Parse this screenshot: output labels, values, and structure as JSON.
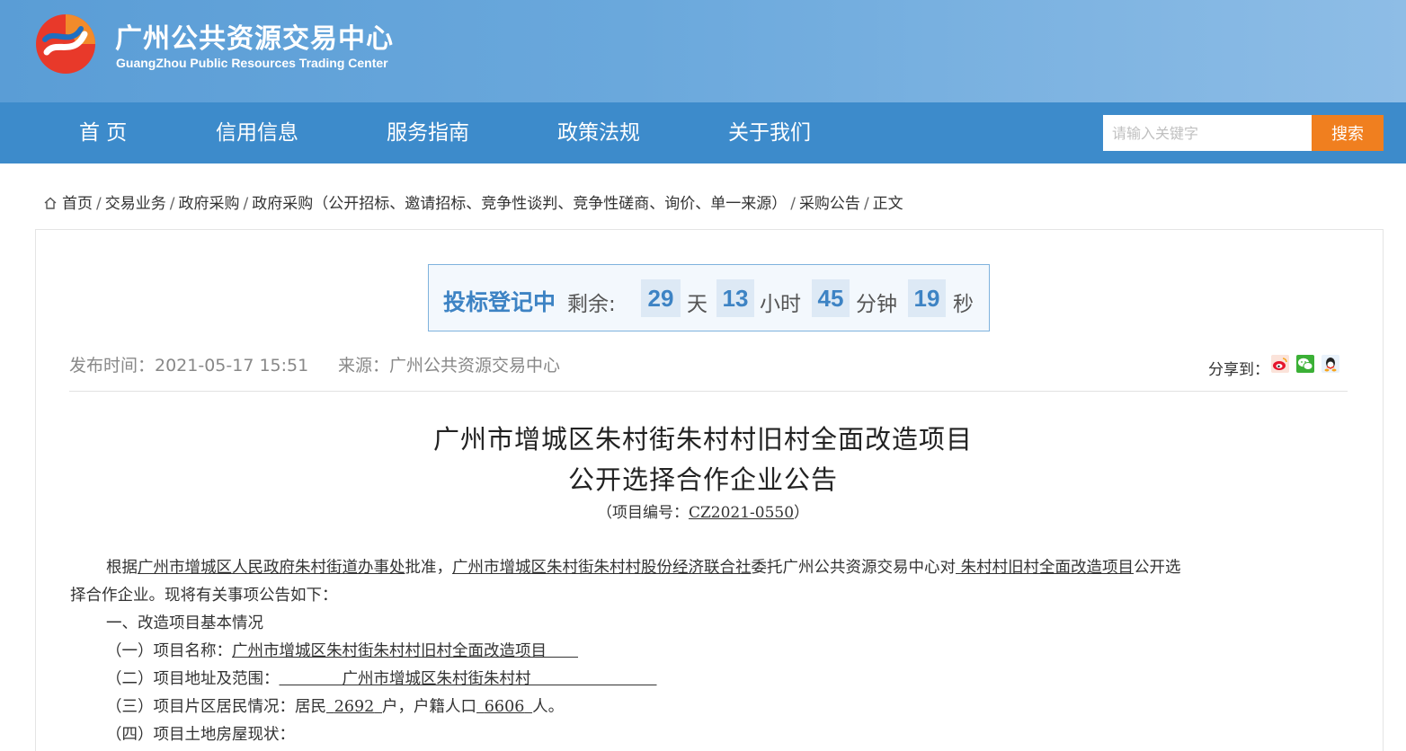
{
  "header": {
    "site_title": "广州公共资源交易中心",
    "site_subtitle": "GuangZhou Public Resources Trading Center",
    "logo_icon": "gzggzy-logo-icon"
  },
  "nav": {
    "items": [
      "首 页",
      "信用信息",
      "服务指南",
      "政策法规",
      "关于我们"
    ],
    "search_placeholder": "请输入关键字",
    "search_button": "搜索"
  },
  "breadcrumb": {
    "items": [
      "首页",
      "交易业务",
      "政府采购",
      "政府采购（公开招标、邀请招标、竞争性谈判、竞争性磋商、询价、单一来源）",
      "采购公告",
      "正文"
    ],
    "separator": "/"
  },
  "countdown": {
    "status": "投标登记中",
    "label": "剩余:",
    "days": "29",
    "days_unit": "天",
    "hours": "13",
    "hours_unit": "小时",
    "minutes": "45",
    "minutes_unit": "分钟",
    "seconds": "19",
    "seconds_unit": "秒"
  },
  "meta": {
    "publish_time": "发布时间：2021-05-17 15:51",
    "source": "来源：广州公共资源交易中心",
    "share_label": "分享到："
  },
  "share_icons": [
    "weibo-icon",
    "wechat-icon",
    "qq-icon"
  ],
  "colors": {
    "accent": "#3d8bcb",
    "search_button": "#f07f1f",
    "countdown": "#3d83c4"
  },
  "document": {
    "title_line1": "广州市增城区朱村街朱村村旧村全面改造项目",
    "title_line2": "公开选择合作企业公告",
    "code_prefix": "（项目编号：",
    "code": "CZ2021-0550",
    "code_suffix": "）",
    "p1_a": "根据",
    "p1_b": "广州市增城区人民政府朱村街道办事处",
    "p1_c": "批准，",
    "p1_d": "广州市增城区朱村街朱村村股份经济联合社",
    "p1_e": "委托广州公共资源交易中心对",
    "p1_f": " 朱村村旧村全面改造项目",
    "p1_g": "公开选",
    "p1_line2": "择合作企业。现将有关事项公告如下：",
    "s1": "一、改造项目基本情况",
    "i1_label": "（一）项目名称：",
    "i1_value": "广州市增城区朱村街朱村村旧村全面改造项目",
    "i2_label": "（二）项目地址及范围：",
    "i2_value": "广州市增城区朱村街朱村村",
    "i3_a": "（三）项目片区居民情况：居民",
    "i3_b": "2692",
    "i3_c": "户，户籍人口",
    "i3_d": "6606",
    "i3_e": "人。",
    "i4_label": "（四）项目土地房屋现状："
  }
}
